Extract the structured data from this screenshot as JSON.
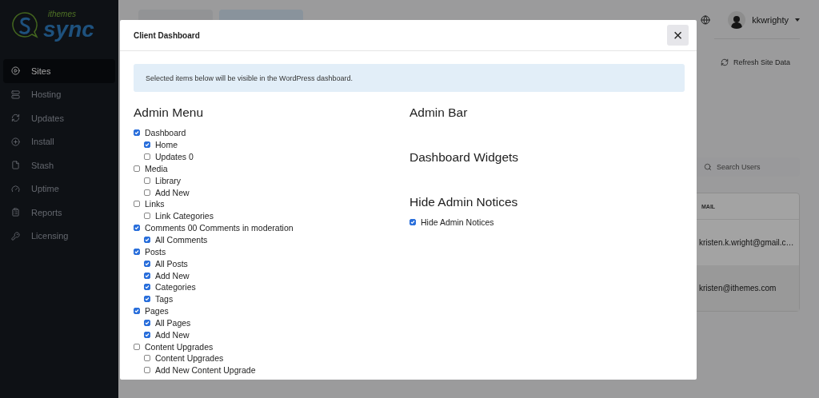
{
  "sidebar": {
    "logo": {
      "small": "ithemes",
      "large": "sync"
    },
    "items": [
      {
        "label": "Sites",
        "selected": true
      },
      {
        "label": "Hosting",
        "selected": false
      },
      {
        "label": "Updates",
        "selected": false
      },
      {
        "label": "Install",
        "selected": false
      },
      {
        "label": "Stash",
        "selected": false
      },
      {
        "label": "Uptime",
        "selected": false
      },
      {
        "label": "Reports",
        "selected": false
      },
      {
        "label": "Licensing",
        "selected": false
      }
    ]
  },
  "topbar": {
    "user": "kkwrighty"
  },
  "refresh": "Refresh Site Data",
  "users": {
    "search": {
      "placeholder": "Search Users"
    },
    "columns": [
      "MAIL"
    ],
    "rows": [
      "kristen.k.wright@gmail.c…",
      "kristen@ithemes.com"
    ]
  },
  "modal": {
    "title": "Client Dashboard",
    "close": "×",
    "notice": "Selected items below will be visible in the WordPress dashboard.",
    "admin_menu": {
      "title": "Admin Menu",
      "items": [
        {
          "label": "Dashboard",
          "checked": true,
          "children": [
            {
              "label": "Home",
              "checked": true
            },
            {
              "label": "Updates 0",
              "checked": false
            }
          ]
        },
        {
          "label": "Media",
          "checked": false,
          "children": [
            {
              "label": "Library",
              "checked": false
            },
            {
              "label": "Add New",
              "checked": false
            }
          ]
        },
        {
          "label": "Links",
          "checked": false,
          "children": [
            {
              "label": "Link Categories",
              "checked": false
            }
          ]
        },
        {
          "label": "Comments 00 Comments in moderation",
          "checked": true,
          "children": [
            {
              "label": "All Comments",
              "checked": true
            }
          ]
        },
        {
          "label": "Posts",
          "checked": true,
          "children": [
            {
              "label": "All Posts",
              "checked": true
            },
            {
              "label": "Add New",
              "checked": true
            },
            {
              "label": "Categories",
              "checked": true
            },
            {
              "label": "Tags",
              "checked": true
            }
          ]
        },
        {
          "label": "Pages",
          "checked": true,
          "children": [
            {
              "label": "All Pages",
              "checked": true
            },
            {
              "label": "Add New",
              "checked": true
            }
          ]
        },
        {
          "label": "Content Upgrades",
          "checked": false,
          "children": [
            {
              "label": "Content Upgrades",
              "checked": false
            },
            {
              "label": "Add New Content Upgrade",
              "checked": false
            }
          ]
        }
      ]
    },
    "sections": [
      {
        "title": "Admin Bar"
      },
      {
        "title": "Dashboard Widgets"
      },
      {
        "title": "Hide Admin Notices",
        "items": [
          {
            "label": "Hide Admin Notices",
            "checked": true
          }
        ]
      }
    ]
  }
}
